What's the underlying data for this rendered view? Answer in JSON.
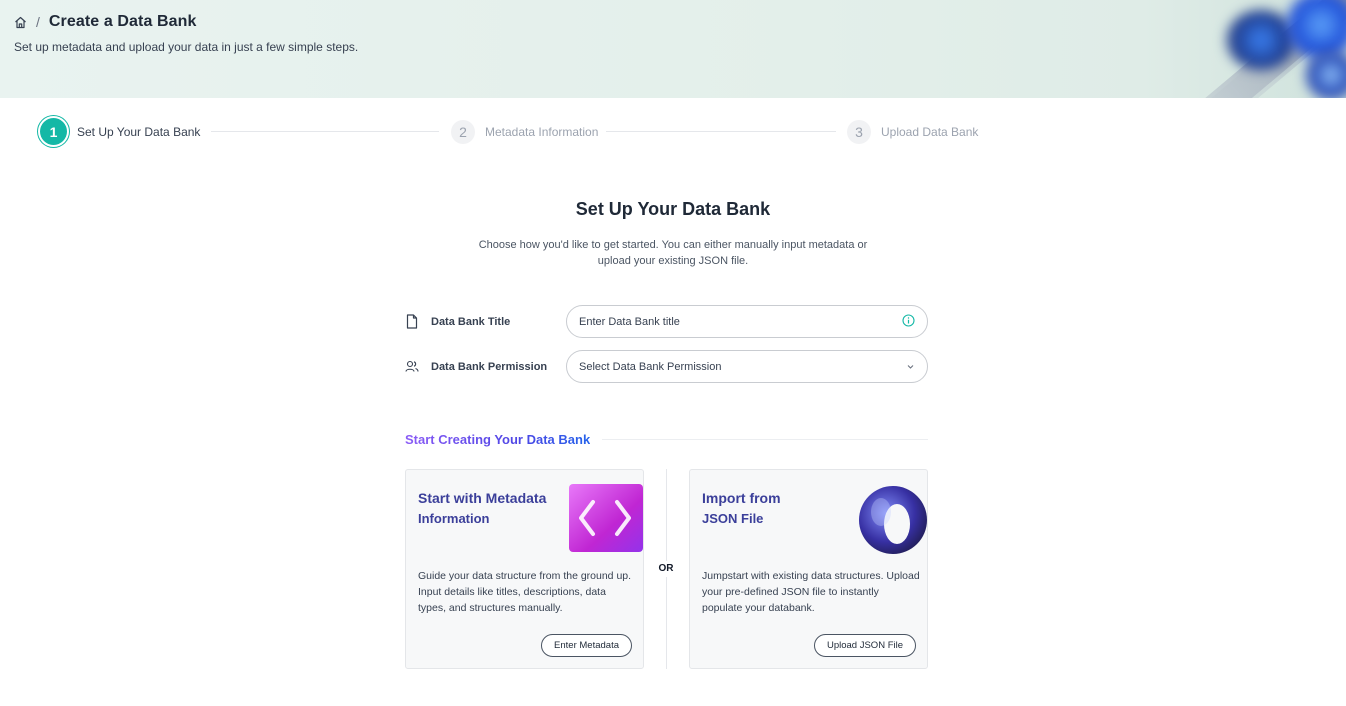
{
  "header": {
    "title": "Create a Data Bank",
    "breadcrumb_separator": "/",
    "subtitle": "Set up metadata and upload your data in just a few simple steps."
  },
  "stepper": {
    "steps": [
      {
        "number": "1",
        "label": "Set Up Your Data Bank",
        "state": "active"
      },
      {
        "number": "2",
        "label": "Metadata Information",
        "state": "inactive"
      },
      {
        "number": "3",
        "label": "Upload Data Bank",
        "state": "inactive"
      }
    ]
  },
  "main": {
    "title": "Set Up Your Data Bank",
    "description": "Choose how you'd like to get started. You can either manually input metadata or upload your existing JSON file."
  },
  "form": {
    "title_field": {
      "label": "Data Bank Title",
      "placeholder": "Enter Data Bank title",
      "icon": "document-icon",
      "trailing_icon": "info-icon"
    },
    "permission_field": {
      "label": "Data Bank Permission",
      "placeholder": "Select Data Bank Permission",
      "icon": "users-icon",
      "trailing_icon": "chevron-down-icon"
    }
  },
  "section": {
    "title": "Start Creating Your Data Bank"
  },
  "options": {
    "or_label": "OR",
    "metadata_card": {
      "title_line1": "Start with Metadata",
      "title_line2": "Information",
      "description": "Guide your data structure from the ground up. Input details like titles, descriptions, data types, and structures manually.",
      "button": "Enter Metadata",
      "icon": "code-brackets-icon"
    },
    "json_card": {
      "title_line1": "Import from",
      "title_line2": "JSON File",
      "description": "Jumpstart with existing data structures. Upload your pre-defined JSON file to instantly populate your databank.",
      "button": "Upload JSON File",
      "icon": "ring-icon"
    }
  },
  "colors": {
    "accent": "#14b8a6",
    "card_title": "#3b3f9a",
    "section_gradient_start": "#8b5cf6",
    "section_gradient_end": "#2563eb"
  }
}
